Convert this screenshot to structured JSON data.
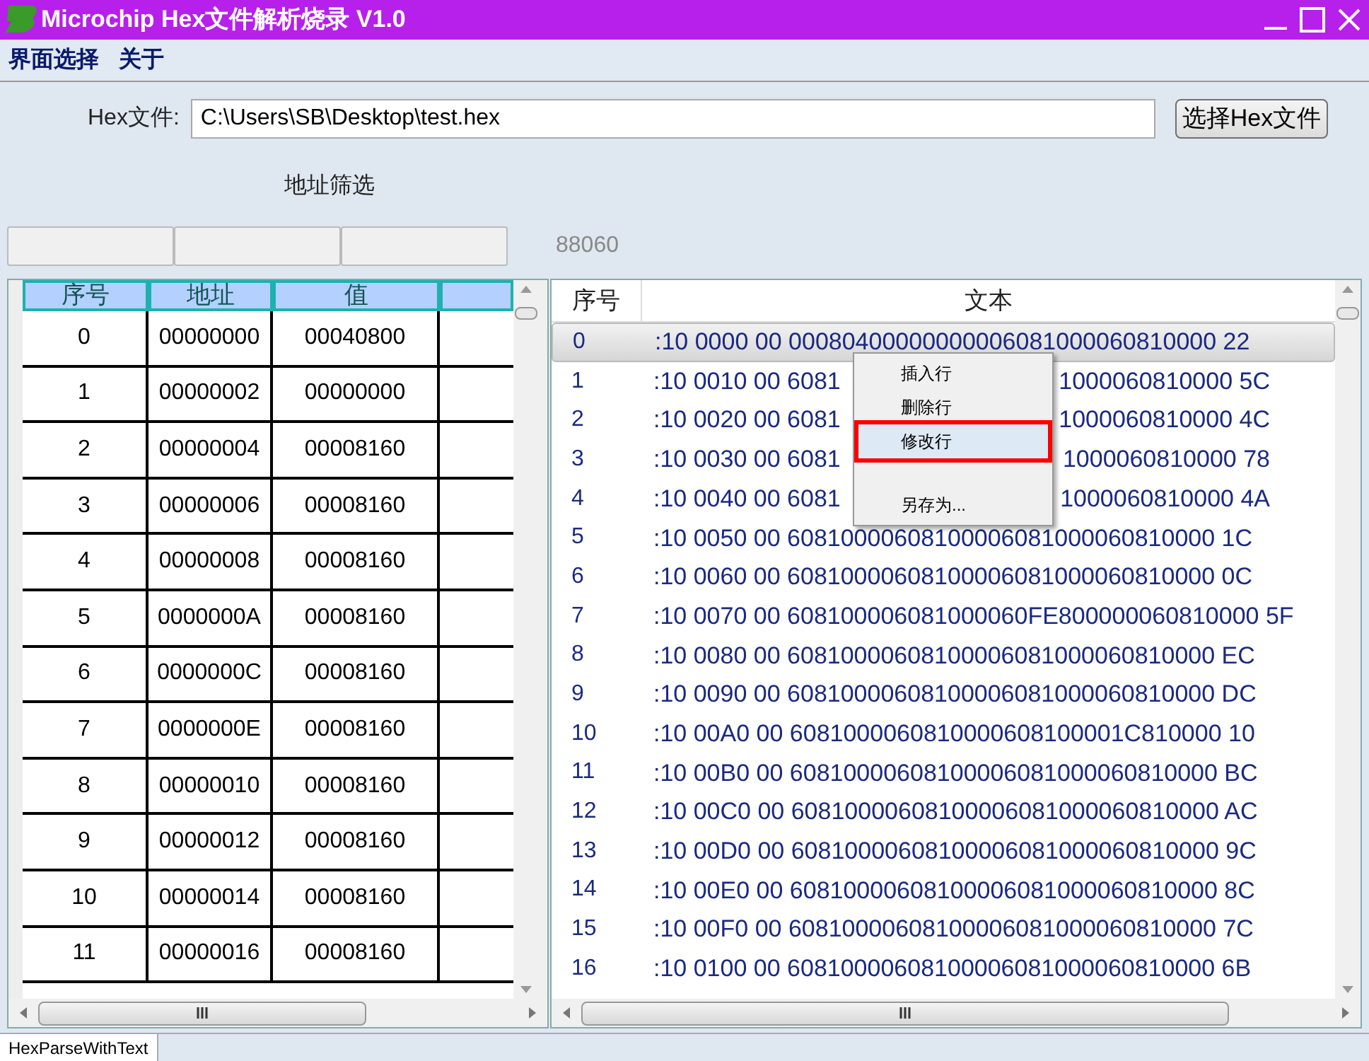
{
  "window": {
    "title": "Microchip Hex文件解析烧录 V1.0"
  },
  "menu": [
    "界面选择",
    "关于"
  ],
  "file": {
    "label": "Hex文件:",
    "value": "C:\\Users\\SB\\Desktop\\test.hex",
    "button": "选择Hex文件"
  },
  "filter": {
    "label": "地址筛选",
    "count": "88060"
  },
  "address_table": {
    "columns": [
      "序号",
      "地址",
      "值"
    ],
    "rows": [
      [
        "0",
        "00000000",
        "00040800"
      ],
      [
        "1",
        "00000002",
        "00000000"
      ],
      [
        "2",
        "00000004",
        "00008160"
      ],
      [
        "3",
        "00000006",
        "00008160"
      ],
      [
        "4",
        "00000008",
        "00008160"
      ],
      [
        "5",
        "0000000A",
        "00008160"
      ],
      [
        "6",
        "0000000C",
        "00008160"
      ],
      [
        "7",
        "0000000E",
        "00008160"
      ],
      [
        "8",
        "00000010",
        "00008160"
      ],
      [
        "9",
        "00000012",
        "00008160"
      ],
      [
        "10",
        "00000014",
        "00008160"
      ],
      [
        "11",
        "00000016",
        "00008160"
      ]
    ]
  },
  "text_table": {
    "columns": [
      "序号",
      "文本"
    ],
    "rows": [
      {
        "index": "0",
        "text": ":10 0000 00 00080400000000006081000060810000 22",
        "selected": true
      },
      {
        "index": "1",
        "text": ":10 0010 00 6081",
        "text_right": "1000060810000 5C",
        "selected": false
      },
      {
        "index": "2",
        "text": ":10 0020 00 6081",
        "text_right": "1000060810000 4C",
        "selected": false
      },
      {
        "index": "3",
        "text": ":10 0030 00 6081",
        "text_right": "1000060810000 78",
        "selected": false
      },
      {
        "index": "4",
        "text": ":10 0040 00 6081",
        "text_right": "1000060810000 4A",
        "selected": false
      },
      {
        "index": "5",
        "text": ":10 0050 00 60810000608100006081000060810000 1C",
        "selected": false
      },
      {
        "index": "6",
        "text": ":10 0060 00 60810000608100006081000060810000 0C",
        "selected": false
      },
      {
        "index": "7",
        "text": ":10 0070 00 608100006081000060FE800000060810000 5F",
        "selected": false
      },
      {
        "index": "8",
        "text": ":10 0080 00 60810000608100006081000060810000 EC",
        "selected": false
      },
      {
        "index": "9",
        "text": ":10 0090 00 60810000608100006081000060810000 DC",
        "selected": false
      },
      {
        "index": "10",
        "text": ":10 00A0 00 6081000060810000608100001C810000 10",
        "selected": false
      },
      {
        "index": "11",
        "text": ":10 00B0 00 60810000608100006081000060810000 BC",
        "selected": false
      },
      {
        "index": "12",
        "text": ":10 00C0 00 60810000608100006081000060810000 AC",
        "selected": false
      },
      {
        "index": "13",
        "text": ":10 00D0 00 60810000608100006081000060810000 9C",
        "selected": false
      },
      {
        "index": "14",
        "text": ":10 00E0 00 60810000608100006081000060810000 8C",
        "selected": false
      },
      {
        "index": "15",
        "text": ":10 00F0 00 60810000608100006081000060810000 7C",
        "selected": false
      },
      {
        "index": "16",
        "text": ":10 0100 00 60810000608100006081000060810000 6B",
        "selected": false
      }
    ]
  },
  "context_menu": [
    {
      "label": "插入行",
      "highlighted": false,
      "kind": "item"
    },
    {
      "label": "删除行",
      "highlighted": false,
      "kind": "item"
    },
    {
      "label": "修改行",
      "highlighted": true,
      "kind": "item"
    },
    {
      "kind": "separator"
    },
    {
      "label": "另存为...",
      "highlighted": false,
      "kind": "item"
    }
  ],
  "status_bar": {
    "tab": "HexParseWithText"
  }
}
